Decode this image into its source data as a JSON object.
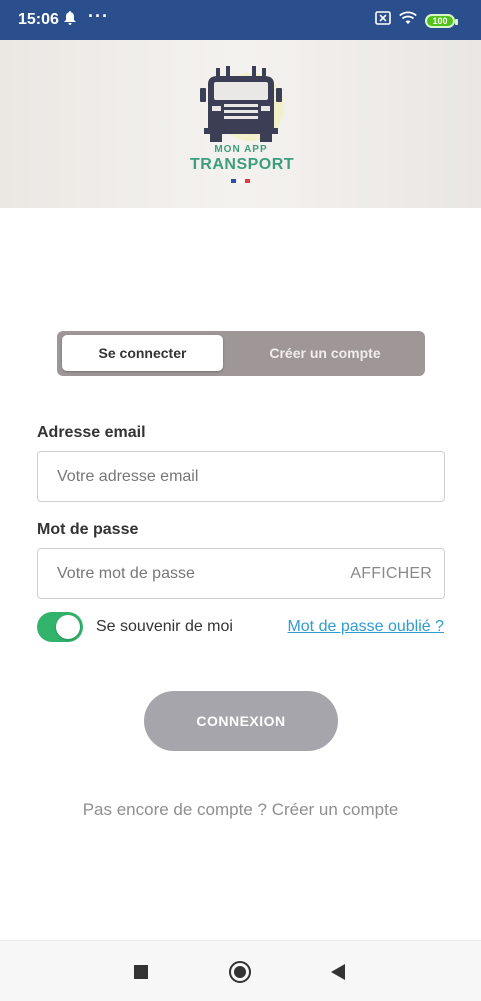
{
  "status_bar": {
    "time": "15:06",
    "battery": "100"
  },
  "banner": {
    "logo_line1": "MON APP",
    "logo_line2": "TRANSPORT"
  },
  "tabs": [
    {
      "label": "Se connecter",
      "active": true
    },
    {
      "label": "Créer un compte",
      "active": false
    }
  ],
  "form": {
    "email_label": "Adresse email",
    "email_placeholder": "Votre adresse email",
    "password_label": "Mot de passe",
    "password_placeholder": "Votre mot de passe",
    "show_password": "AFFICHER",
    "remember_label": "Se souvenir de moi",
    "remember_on": true,
    "forgot_link": "Mot de passe oublié ?",
    "submit": "CONNEXION",
    "signup_prompt": "Pas encore de compte ? Créer un compte"
  },
  "colors": {
    "status_bar": "#2a4f8c",
    "segment_bg": "#9e9697",
    "toggle_on": "#31b36b",
    "link": "#2f9bd0",
    "button": "#a6a5ab",
    "logo_text": "#3e9d7c"
  },
  "icons": {
    "notification": "bell-icon",
    "more": "more-dots-icon",
    "sim": "sim-icon",
    "wifi": "wifi-icon",
    "battery": "battery-icon",
    "nav_recent": "recent-apps-icon",
    "nav_home": "home-icon",
    "nav_back": "back-icon"
  }
}
